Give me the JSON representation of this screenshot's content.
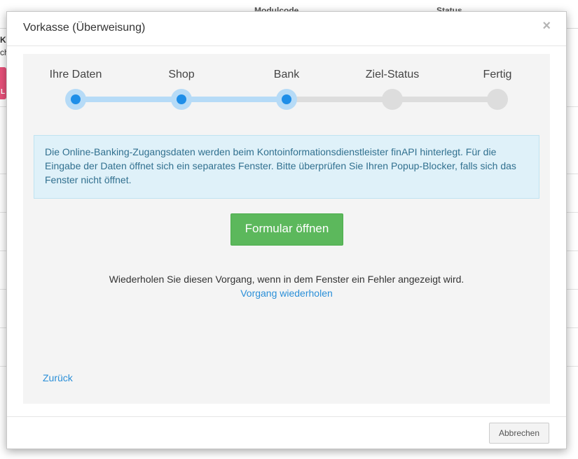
{
  "background": {
    "columns": [
      "Modulcode",
      "Status"
    ],
    "left_fragments": [
      "Kla",
      "ch"
    ],
    "pink_button_letter": "L"
  },
  "modal": {
    "title": "Vorkasse (Überweisung)",
    "close_symbol": "×",
    "steps": [
      {
        "label": "Ihre Daten",
        "done": true
      },
      {
        "label": "Shop",
        "done": true
      },
      {
        "label": "Bank",
        "done": true
      },
      {
        "label": "Ziel-Status",
        "done": false
      },
      {
        "label": "Fertig",
        "done": false
      }
    ],
    "info_text": "Die Online-Banking-Zugangsdaten werden beim Kontoinformationsdienstleister finAPI hinterlegt. Für die Eingabe der Daten öffnet sich ein separates Fenster. Bitte überprüfen Sie Ihren Popup-Blocker, falls sich das Fenster nicht öffnet.",
    "open_form_button": "Formular öffnen",
    "retry_text": "Wiederholen Sie diesen Vorgang, wenn in dem Fenster ein Fehler angezeigt wird.",
    "retry_link": "Vorgang wiederholen",
    "back_link": "Zurück",
    "cancel_button": "Abbrechen"
  },
  "colors": {
    "step_done": "#1e8ee8",
    "step_done_ring": "#b6dbf7",
    "step_todo": "#dddddd",
    "primary_button": "#5cb85c",
    "link": "#2a8fd8",
    "info_bg": "#dff1f9"
  }
}
